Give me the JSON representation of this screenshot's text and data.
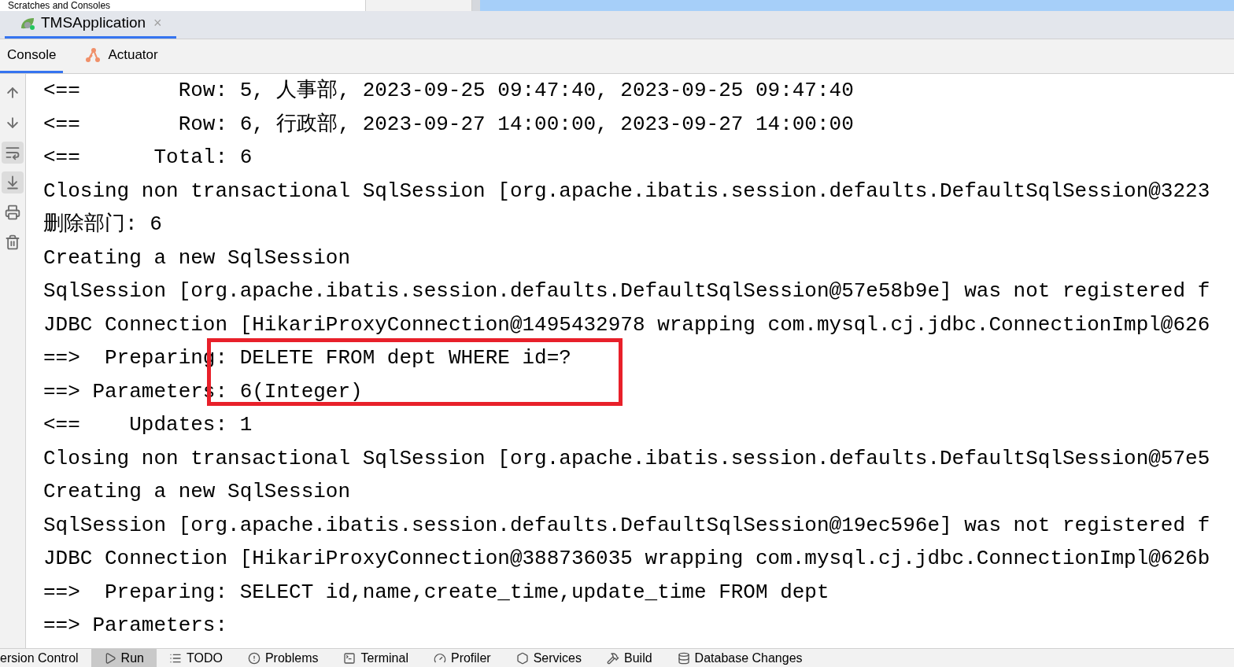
{
  "top_strip": {
    "title": "Scratches and Consoles"
  },
  "run_tabs": [
    {
      "label": "TMSApplication",
      "selected": true,
      "close": "×"
    }
  ],
  "console_tabs": [
    {
      "label": "Console",
      "selected": true
    },
    {
      "label": "Actuator",
      "selected": false
    }
  ],
  "gutter_tools": [
    {
      "on": false
    },
    {
      "on": false
    },
    {
      "on": true
    },
    {
      "on": true
    },
    {
      "on": false
    },
    {
      "on": false
    }
  ],
  "console_lines": [
    "<==        Row: 5, 人事部, 2023-09-25 09:47:40, 2023-09-25 09:47:40",
    "<==        Row: 6, 行政部, 2023-09-27 14:00:00, 2023-09-27 14:00:00",
    "<==      Total: 6",
    "Closing non transactional SqlSession [org.apache.ibatis.session.defaults.DefaultSqlSession@3223",
    "删除部门: 6",
    "Creating a new SqlSession",
    "SqlSession [org.apache.ibatis.session.defaults.DefaultSqlSession@57e58b9e] was not registered f",
    "JDBC Connection [HikariProxyConnection@1495432978 wrapping com.mysql.cj.jdbc.ConnectionImpl@626",
    "==>  Preparing: DELETE FROM dept WHERE id=?",
    "==> Parameters: 6(Integer)",
    "<==    Updates: 1",
    "Closing non transactional SqlSession [org.apache.ibatis.session.defaults.DefaultSqlSession@57e5",
    "Creating a new SqlSession",
    "SqlSession [org.apache.ibatis.session.defaults.DefaultSqlSession@19ec596e] was not registered f",
    "JDBC Connection [HikariProxyConnection@388736035 wrapping com.mysql.cj.jdbc.ConnectionImpl@626b",
    "==>  Preparing: SELECT id,name,create_time,update_time FROM dept",
    "==> Parameters:"
  ],
  "bottom_tools": [
    {
      "label": "ersion Control",
      "selected": false
    },
    {
      "label": "Run",
      "selected": true
    },
    {
      "label": "TODO",
      "selected": false
    },
    {
      "label": "Problems",
      "selected": false
    },
    {
      "label": "Terminal",
      "selected": false
    },
    {
      "label": "Profiler",
      "selected": false
    },
    {
      "label": "Services",
      "selected": false
    },
    {
      "label": "Build",
      "selected": false
    },
    {
      "label": "Database Changes",
      "selected": false
    }
  ]
}
